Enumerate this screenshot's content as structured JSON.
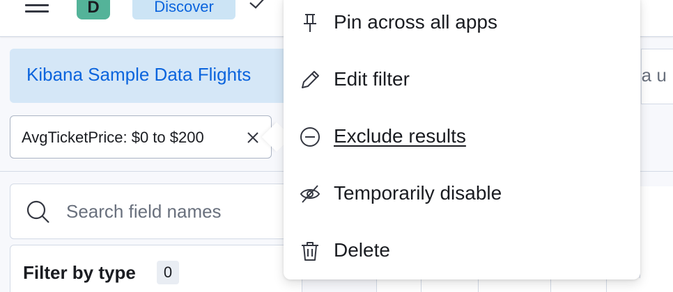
{
  "header": {
    "avatar_initial": "D",
    "breadcrumb": "Discover"
  },
  "dataview": {
    "label": "Kibana Sample Data Flights",
    "right_partial_text": "ata u"
  },
  "filter_pill": {
    "label": "AvgTicketPrice: $0 to $200"
  },
  "sidebar": {
    "search_placeholder": "Search field names",
    "filter_by_type_label": "Filter by type",
    "filter_by_type_count": "0"
  },
  "context_menu": {
    "items": [
      {
        "label": "Pin across all apps",
        "icon": "pin-icon"
      },
      {
        "label": "Edit filter",
        "icon": "pencil-icon"
      },
      {
        "label": "Exclude results",
        "icon": "minus-circle-icon"
      },
      {
        "label": "Temporarily disable",
        "icon": "eye-closed-icon"
      },
      {
        "label": "Delete",
        "icon": "trash-icon"
      }
    ]
  },
  "colors": {
    "accent": "#0b64dd",
    "breadcrumb_bg": "#cce4f5",
    "avatar_bg": "#54b399"
  }
}
